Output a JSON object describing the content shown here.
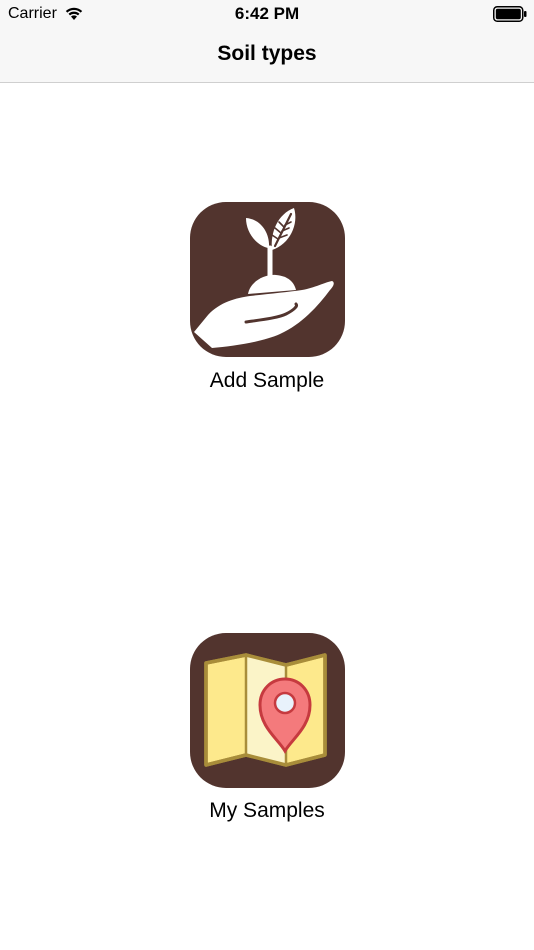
{
  "status_bar": {
    "carrier": "Carrier",
    "time": "6:42 PM",
    "wifi_icon": "wifi-icon",
    "battery_icon": "battery-full-icon"
  },
  "nav": {
    "title": "Soil types"
  },
  "actions": {
    "add_sample": {
      "label": "Add Sample",
      "icon": "plant-in-hand-icon"
    },
    "my_samples": {
      "label": "My Samples",
      "icon": "map-pin-icon"
    }
  },
  "colors": {
    "tile_background": "#52342e",
    "map_fill": "#fde98c",
    "map_border": "#a88d3a",
    "pin_fill": "#f47a7c",
    "pin_stroke": "#c63a3f"
  }
}
